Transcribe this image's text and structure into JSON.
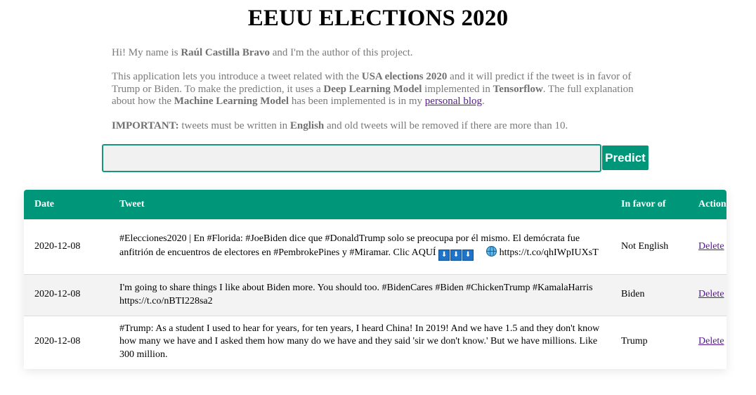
{
  "page": {
    "title": "EEUU ELECTIONS 2020"
  },
  "intro": {
    "p1_prefix": "Hi! My name is ",
    "p1_name": "Raúl Castilla Bravo",
    "p1_suffix": " and I'm the author of this project.",
    "p2_part1": "This application lets you introduce a tweet related with the ",
    "p2_bold1": "USA elections 2020",
    "p2_part2": " and it will predict if the tweet is in favor of Trump or Biden. To make the prediction, it uses a ",
    "p2_bold2": "Deep Learning Model",
    "p2_part3": " implemented in ",
    "p2_bold3": "Tensorflow",
    "p2_part4": ". The full explanation about how the ",
    "p2_bold4": "Machine Learning Model",
    "p2_part5": " has been implemented is in my ",
    "p2_link": "personal blog",
    "p2_part6": ".",
    "p3_bold1": "IMPORTANT:",
    "p3_part1": " tweets must be written in ",
    "p3_bold2": "English",
    "p3_part2": " and old tweets will be removed if there are more than 10."
  },
  "form": {
    "input_value": "",
    "input_placeholder": "",
    "predict_label": "Predict"
  },
  "table": {
    "headers": {
      "date": "Date",
      "tweet": "Tweet",
      "favor": "In favor of",
      "action": "Action"
    },
    "rows": [
      {
        "date": "2020-12-08",
        "tweet_text": "#Elecciones2020 | En #Florida: #JoeBiden dice que #DonaldTrump solo se preocupa por él mismo. El demócrata fue anfitrión de encuentros de electores en #PembrokePines y #Miramar. Clic AQUÍ",
        "tweet_emoji": "⬇",
        "tweet_link": "https://t.co/qhIWpIUXsT",
        "favor": "Not English",
        "action": "Delete"
      },
      {
        "date": "2020-12-08",
        "tweet_text": "I'm going to share things I like about Biden more. You should too. #BidenCares #Biden #ChickenTrump #KamalaHarris https://t.co/nBTI228sa2",
        "favor": "Biden",
        "action": "Delete"
      },
      {
        "date": "2020-12-08",
        "tweet_text": "#Trump: As a student I used to hear for years, for ten years, I heard China! In 2019! And we have 1.5 and they don't know how many we have and I asked them how many do we have and they said 'sir we don't know.' But we have millions. Like 300 million.",
        "favor": "Trump",
        "action": "Delete"
      }
    ]
  },
  "colors": {
    "accent": "#00967a",
    "intro_text": "#7a7a7a",
    "link": "#551a8b"
  }
}
